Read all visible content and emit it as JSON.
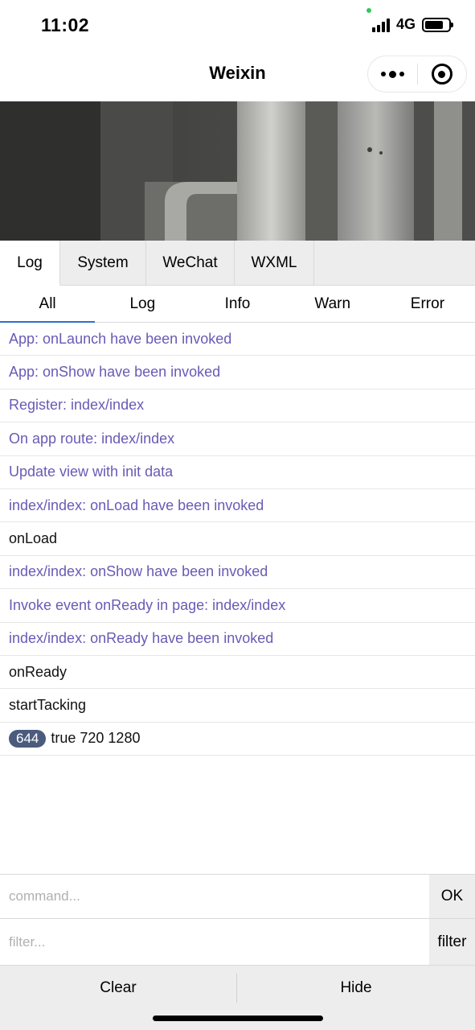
{
  "status_bar": {
    "time": "11:02",
    "network": "4G"
  },
  "nav": {
    "title": "Weixin"
  },
  "console_tabs": [
    "Log",
    "System",
    "WeChat",
    "WXML"
  ],
  "log_filters": [
    "All",
    "Log",
    "Info",
    "Warn",
    "Error"
  ],
  "logs": [
    {
      "text": "App: onLaunch have been invoked"
    },
    {
      "text": "App: onShow have been invoked"
    },
    {
      "text": "Register: index/index"
    },
    {
      "text": "On app route: index/index"
    },
    {
      "text": "Update view with init data"
    },
    {
      "text": "index/index: onLoad have been invoked"
    },
    {
      "text": "onLoad"
    },
    {
      "text": "index/index: onShow have been invoked"
    },
    {
      "text": "Invoke event onReady in page: index/index"
    },
    {
      "text": "index/index: onReady have been invoked"
    },
    {
      "text": "onReady"
    },
    {
      "text": "startTacking"
    },
    {
      "badge": "644",
      "text": "true 720 1280"
    }
  ],
  "command": {
    "placeholder": "command...",
    "ok_label": "OK"
  },
  "filter": {
    "placeholder": "filter...",
    "filter_label": "filter"
  },
  "footer": {
    "clear_label": "Clear",
    "hide_label": "Hide"
  },
  "colors": {
    "system_log": "#6a5ab5",
    "user_log": "#111111",
    "active_tab_underline": "#2f6fd0",
    "badge_bg": "#4a5b7d"
  }
}
